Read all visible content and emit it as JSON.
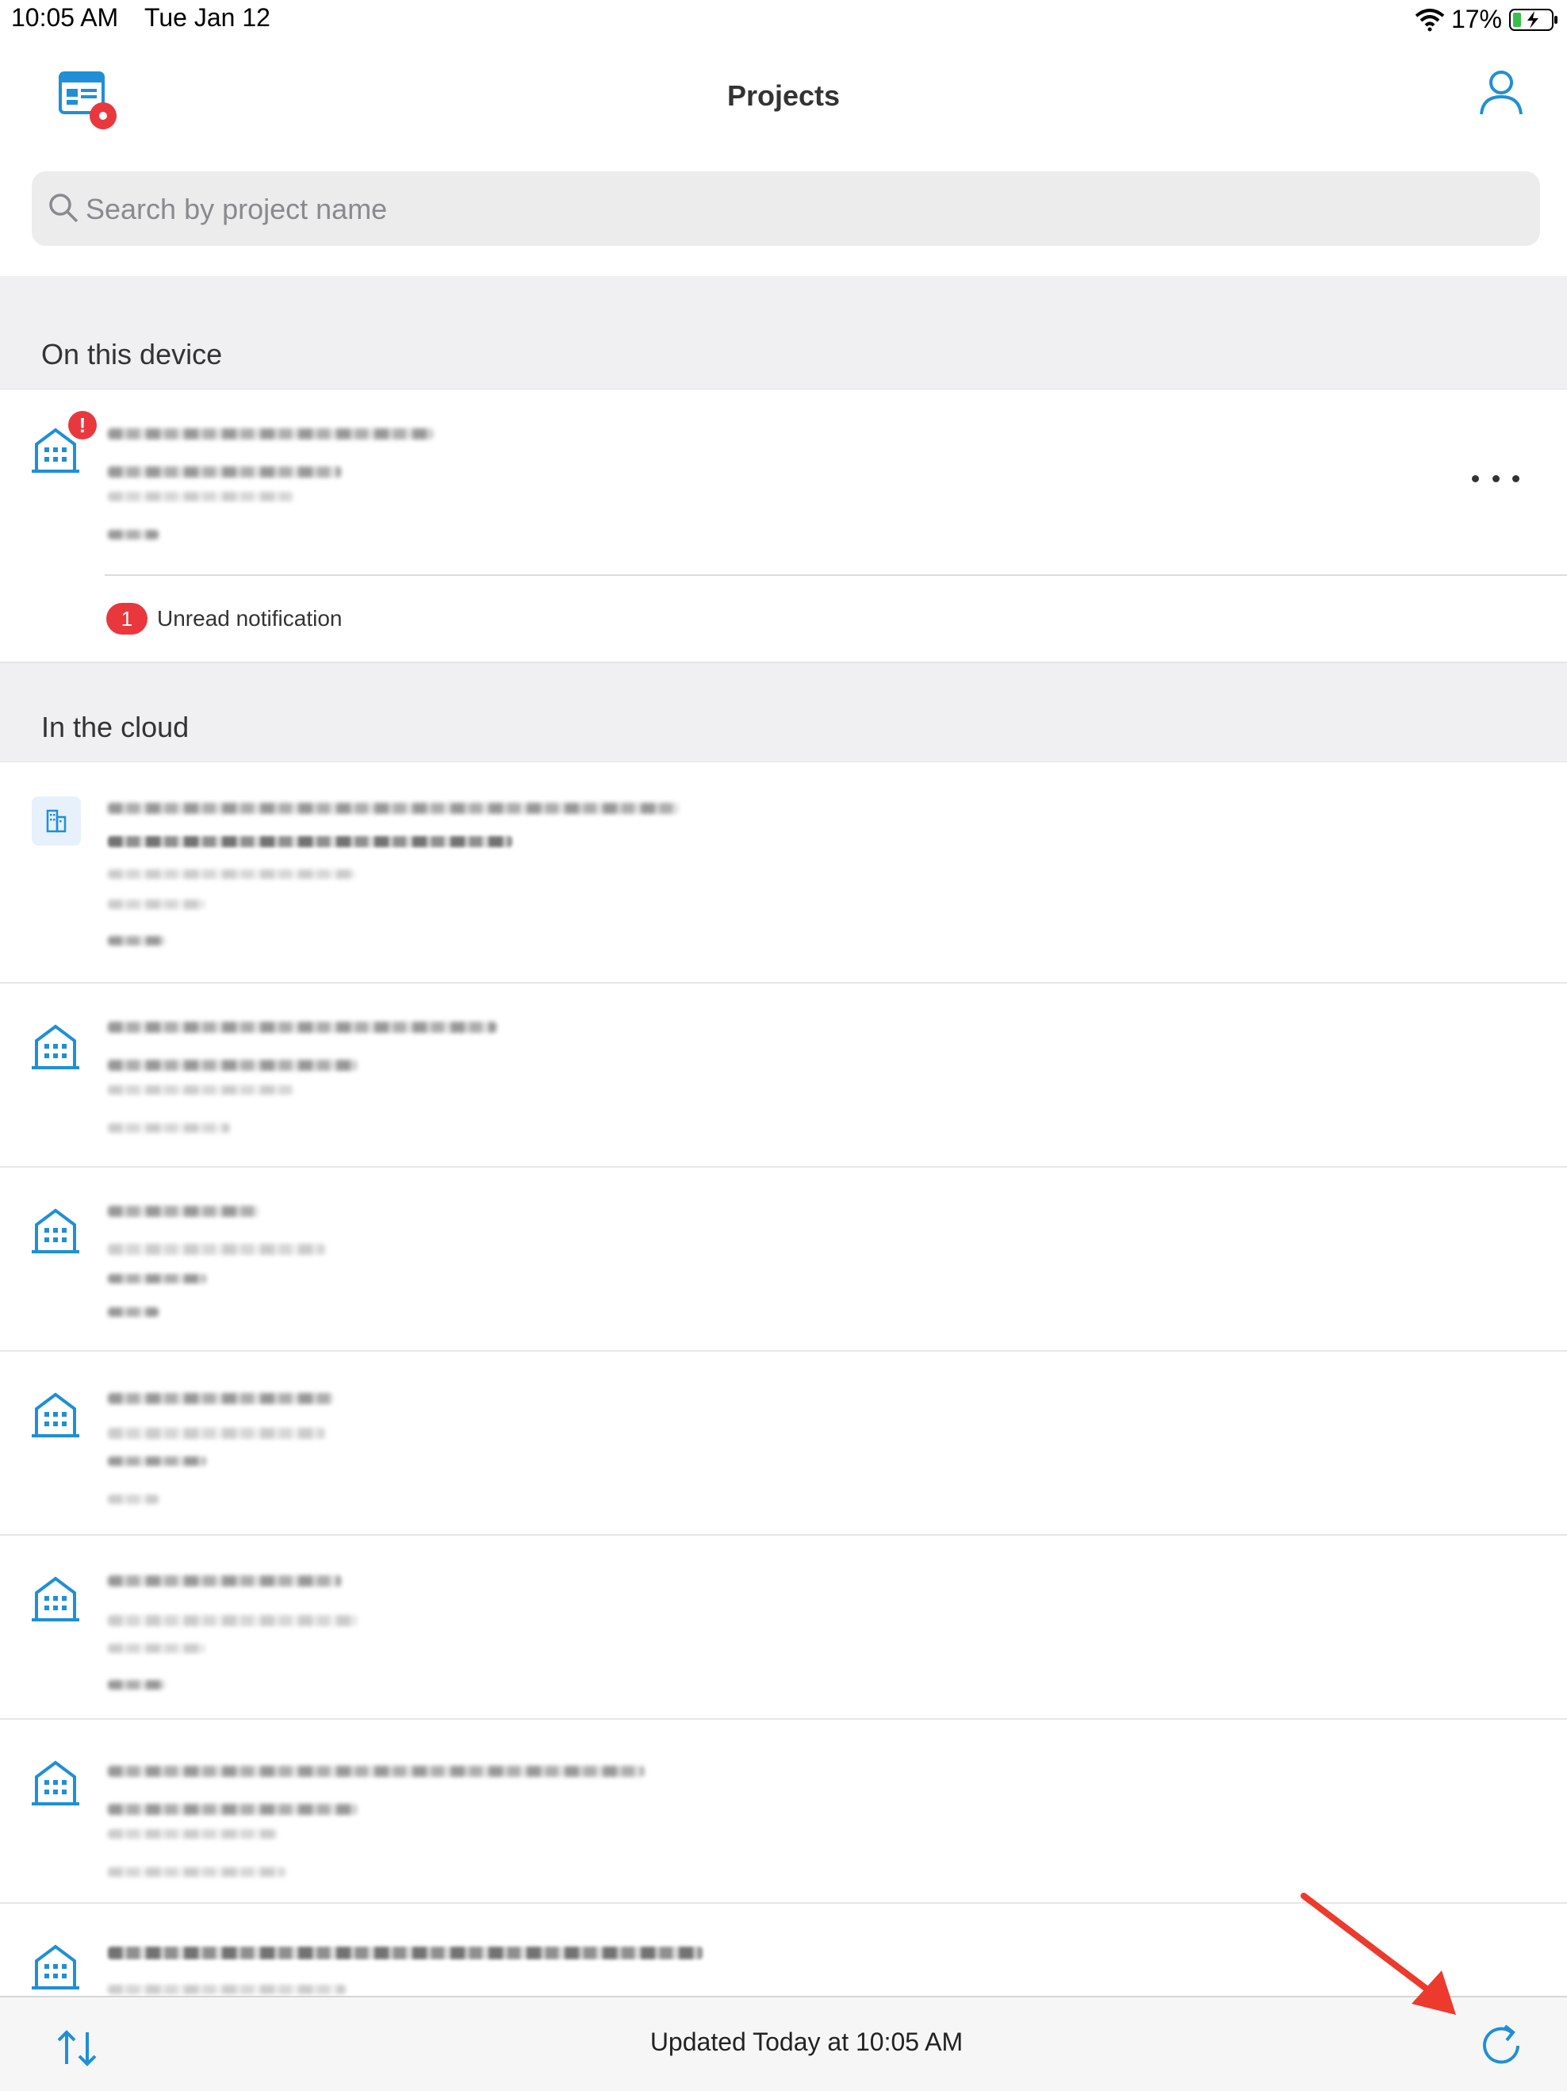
{
  "status_bar": {
    "time": "10:05 AM",
    "date": "Tue Jan 12",
    "battery": "17%"
  },
  "nav": {
    "title": "Projects"
  },
  "search": {
    "placeholder": "Search by project name"
  },
  "sections": {
    "device": "On this device",
    "cloud": "In the cloud"
  },
  "device_project": {
    "notification_count": "1",
    "notification_label": "Unread notification"
  },
  "bottom_bar": {
    "updated": "Updated Today at 10:05 AM"
  },
  "colors": {
    "accent": "#1f8fd6",
    "alert": "#e9383d",
    "annotation_arrow": "#ec3a2c"
  },
  "icons": [
    "app-logo-icon",
    "profile-icon",
    "search-icon",
    "building-icon",
    "alert-icon",
    "more-icon",
    "sort-icon",
    "refresh-icon"
  ]
}
